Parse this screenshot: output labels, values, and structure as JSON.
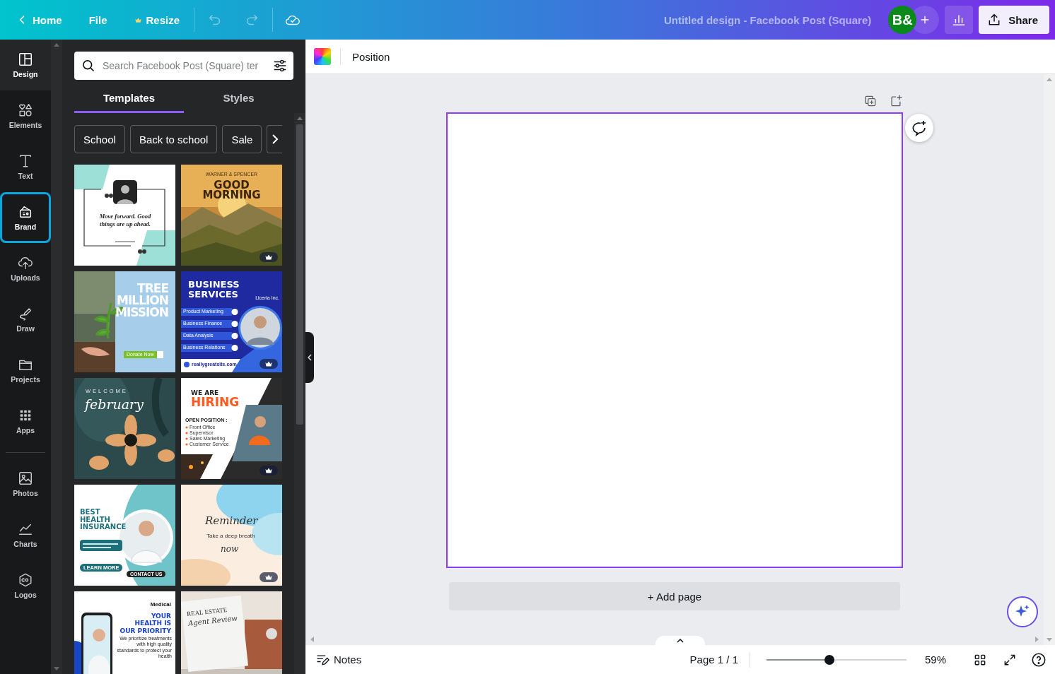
{
  "top_bar": {
    "home": "Home",
    "file": "File",
    "resize": "Resize",
    "title": "Untitled design - Facebook Post (Square)",
    "avatar": "B&",
    "share": "Share"
  },
  "rail_groups": [
    [
      {
        "label": "Design",
        "kind": "design",
        "selected": true,
        "focused": false
      },
      {
        "label": "Elements",
        "kind": "elements",
        "selected": false,
        "focused": false
      },
      {
        "label": "Text",
        "kind": "text",
        "selected": false,
        "focused": false
      },
      {
        "label": "Brand",
        "kind": "brand",
        "selected": false,
        "focused": true
      },
      {
        "label": "Uploads",
        "kind": "uploads",
        "selected": false,
        "focused": false
      },
      {
        "label": "Draw",
        "kind": "draw",
        "selected": false,
        "focused": false
      },
      {
        "label": "Projects",
        "kind": "projects",
        "selected": false,
        "focused": false
      },
      {
        "label": "Apps",
        "kind": "apps",
        "selected": false,
        "focused": false
      }
    ],
    [
      {
        "label": "Photos",
        "kind": "photos",
        "selected": false,
        "focused": false
      },
      {
        "label": "Charts",
        "kind": "charts",
        "selected": false,
        "focused": false
      },
      {
        "label": "Logos",
        "kind": "logos",
        "selected": false,
        "focused": false
      }
    ]
  ],
  "panel": {
    "search": {
      "placeholder": "Search Facebook Post (Square) ter"
    },
    "tabs": [
      {
        "label": "Templates",
        "selected": true
      },
      {
        "label": "Styles",
        "selected": false
      }
    ],
    "chips": [
      "School",
      "Back to school",
      "Sale"
    ],
    "templates": [
      {
        "kind": "quote",
        "quote": "Move forward. Good things are up ahead."
      },
      {
        "kind": "sunrise",
        "brand": "WARNER & SPENCER",
        "headline": [
          "GOOD",
          "MORNING"
        ],
        "premium": true
      },
      {
        "kind": "plant",
        "headline": [
          "TREE",
          "MILLION",
          "MISSION"
        ],
        "button": "Donate Now"
      },
      {
        "kind": "business",
        "headline": [
          "BUSINESS",
          "SERVICES"
        ],
        "company": "Liceria Inc.",
        "items": [
          "Product Marketing",
          "Business Finance",
          "Data Analysis",
          "Business Relations"
        ],
        "website": "reallygreatsite.com",
        "premium": true
      },
      {
        "kind": "flower",
        "overline": "WELCOME",
        "script": "february"
      },
      {
        "kind": "hiring",
        "headline": [
          "WE ARE",
          "HIRING"
        ],
        "subtitle": "OPEN POSITION :",
        "items": [
          "Front Office",
          "Supervisor",
          "Sales Marketing",
          "Customer Service"
        ],
        "premium": true
      },
      {
        "kind": "insurance",
        "headline": [
          "BEST",
          "HEALTH",
          "INSURANCE"
        ],
        "button": "LEARN MORE",
        "contact": "CONTACT US"
      },
      {
        "kind": "reminder",
        "script": "Reminder",
        "line": "Take a deep breath",
        "script2": "now",
        "premium": true
      },
      {
        "kind": "medical",
        "brand": "Medical",
        "headline": [
          "YOUR",
          "HEALTH IS",
          "OUR PRIORITY"
        ],
        "body": "We prioritize treatments with high quality standards to protect your health"
      },
      {
        "kind": "real_estate",
        "headline": "REAL ESTATE",
        "script": "Agent Review"
      }
    ]
  },
  "toolbar": {
    "position": "Position"
  },
  "canvas": {
    "add_page": "+ Add page"
  },
  "bottom_bar": {
    "notes": "Notes",
    "page": "Page 1 / 1",
    "zoom": {
      "level": 0.45
    },
    "zoom_reading": "59%"
  }
}
